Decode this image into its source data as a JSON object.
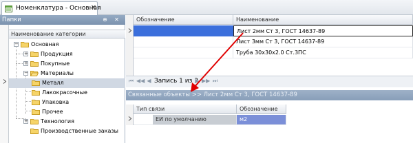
{
  "tab": {
    "label": "Номенклатура - Основная",
    "close": "✕"
  },
  "left_panel": {
    "title": "Папки",
    "pin": "⊕",
    "close": "✕",
    "column_header": "Наименование категории",
    "tree": [
      {
        "label": "Основная",
        "level": 0,
        "toggle": "−"
      },
      {
        "label": "Продукция",
        "level": 1,
        "toggle": "+"
      },
      {
        "label": "Покупные",
        "level": 1,
        "toggle": "+"
      },
      {
        "label": "Материалы",
        "level": 1,
        "toggle": "−"
      },
      {
        "label": "Металл",
        "level": 2,
        "toggle": "",
        "selected": true
      },
      {
        "label": "Лакокрасочные",
        "level": 2,
        "toggle": ""
      },
      {
        "label": "Упаковка",
        "level": 2,
        "toggle": ""
      },
      {
        "label": "Прочее",
        "level": 2,
        "toggle": ""
      },
      {
        "label": "Технология",
        "level": 1,
        "toggle": "+"
      },
      {
        "label": "Производственные заказы",
        "level": 1,
        "toggle": ""
      }
    ]
  },
  "grid": {
    "columns": [
      "Обозначение",
      "Наименование"
    ],
    "rows": [
      {
        "designation": "",
        "name": "Лист 2мм Ст 3, ГОСТ 14637-89",
        "selected": true
      },
      {
        "designation": "",
        "name": "Лист 3мм Ст 3, ГОСТ 14637-89"
      },
      {
        "designation": "",
        "name": "Труба 30х30х2.0 Ст.3ПС"
      }
    ]
  },
  "navigator": {
    "text": "Запись 1 из 3"
  },
  "related": {
    "title": "Связанные объекты >> Лист 2мм Ст 3, ГОСТ 14637-89",
    "columns": [
      "Тип связи",
      "Обозначение о..."
    ],
    "rows": [
      {
        "type": "ЕИ по умолчанию",
        "designation": "м2"
      }
    ]
  },
  "colors": {
    "selection": "#3b6fdc",
    "arrow": "#e00000",
    "panel_header": "#889eb9"
  }
}
